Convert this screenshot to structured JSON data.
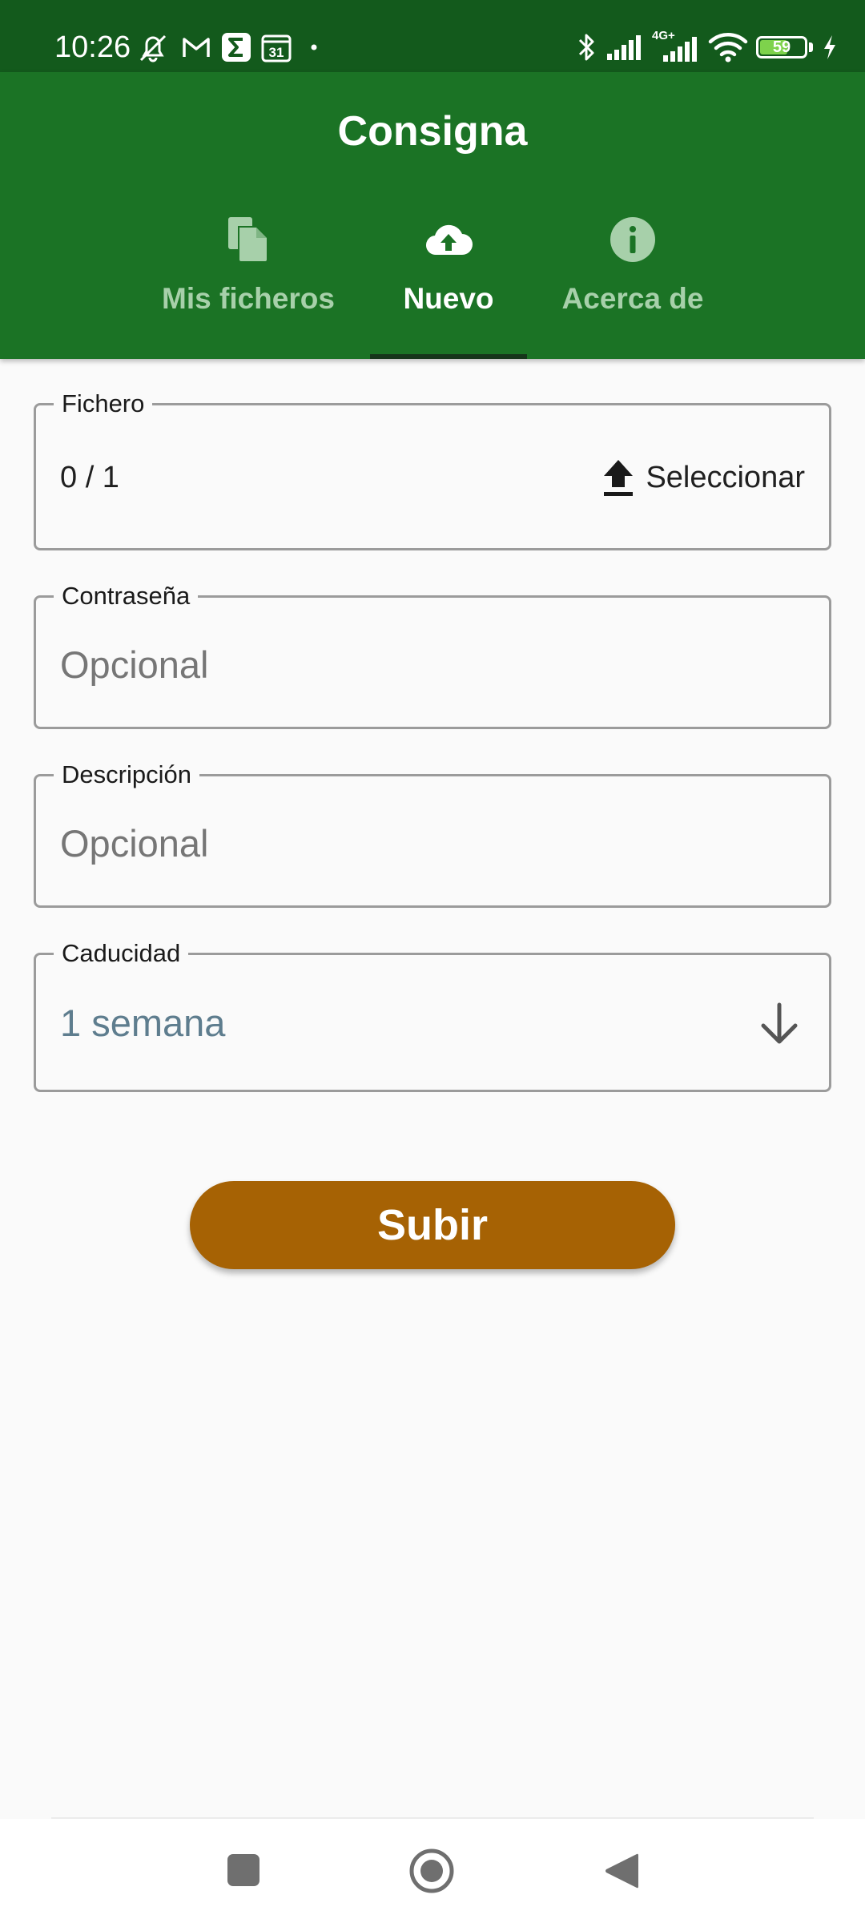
{
  "status_bar": {
    "time": "10:26",
    "network": "4G+",
    "battery_level": "59",
    "left_icons": [
      "muted-alarm-icon",
      "gmail-icon",
      "sigma-app-icon",
      "calendar-icon",
      "dot-icon"
    ],
    "calendar_day": "31",
    "right_icons": [
      "bluetooth-icon",
      "signal-icon",
      "signal-4g-icon",
      "wifi-icon",
      "battery-icon",
      "charging-icon"
    ]
  },
  "app_bar": {
    "title": "Consigna",
    "tabs": [
      {
        "label": "Mis ficheros",
        "icon": "files-icon",
        "active": false
      },
      {
        "label": "Nuevo",
        "icon": "cloud-upload-icon",
        "active": true
      },
      {
        "label": "Acerca de",
        "icon": "info-icon",
        "active": false
      }
    ]
  },
  "form": {
    "file": {
      "label": "Fichero",
      "count": "0 / 1",
      "select_label": "Seleccionar",
      "select_icon": "upload-icon"
    },
    "password": {
      "label": "Contraseña",
      "placeholder": "Opcional",
      "value": ""
    },
    "description": {
      "label": "Descripción",
      "placeholder": "Opcional",
      "value": ""
    },
    "expiry": {
      "label": "Caducidad",
      "value": "1 semana",
      "icon": "arrow-down-icon"
    },
    "submit_label": "Subir"
  },
  "colors": {
    "status_bar": "#135a1c",
    "app_bar": "#1b7325",
    "tab_inactive": "#a7d0aa",
    "tab_indicator": "#16351a",
    "submit_button": "#a66204",
    "background": "#fafafa"
  },
  "nav_bar": {
    "buttons": [
      "recents-button",
      "home-button",
      "back-button"
    ]
  }
}
